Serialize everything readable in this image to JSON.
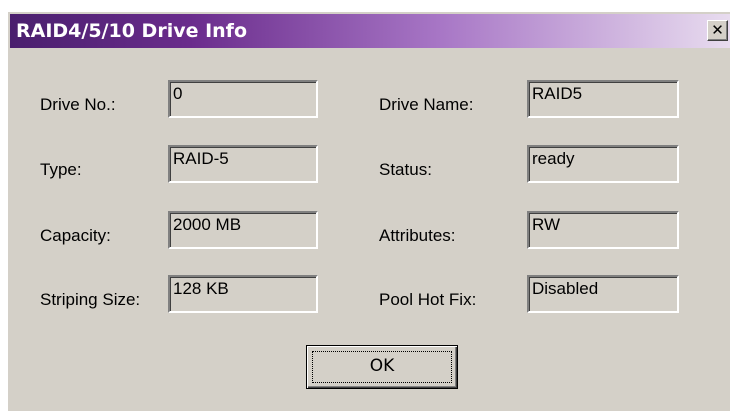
{
  "window": {
    "title": "RAID4/5/10 Drive Info",
    "close_label": "✕"
  },
  "fields": {
    "drive_no": {
      "label": "Drive No.:",
      "value": "0"
    },
    "drive_name": {
      "label": "Drive Name:",
      "value": "RAID5"
    },
    "type": {
      "label": "Type:",
      "value": "RAID-5"
    },
    "status": {
      "label": "Status:",
      "value": "ready"
    },
    "capacity": {
      "label": "Capacity:",
      "value": "2000 MB"
    },
    "attributes": {
      "label": "Attributes:",
      "value": "RW"
    },
    "striping_size": {
      "label": "Striping Size:",
      "value": "128 KB"
    },
    "pool_hot_fix": {
      "label": "Pool Hot Fix:",
      "value": "Disabled"
    }
  },
  "buttons": {
    "ok_label": "OK"
  },
  "colors": {
    "titlebar_start": "#4a1f6e",
    "titlebar_end": "#e8dcef",
    "dialog_bg": "#d4d0c8"
  },
  "icons": {
    "close": "close-icon"
  }
}
